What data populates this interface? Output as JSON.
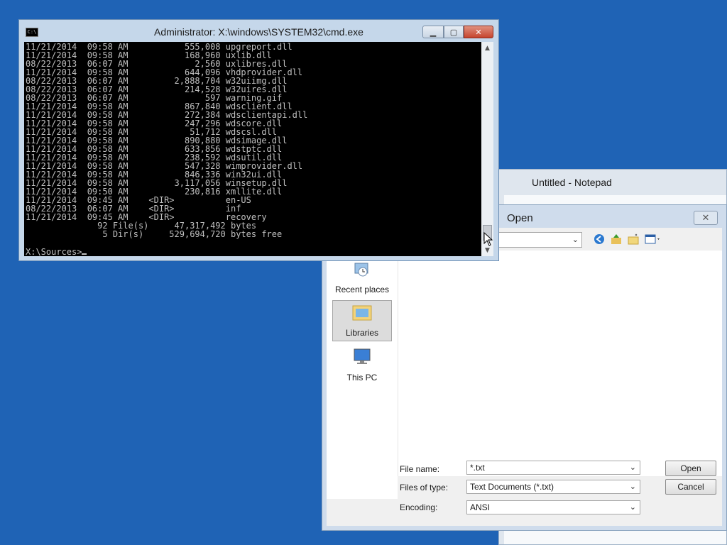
{
  "notepad": {
    "title": "Untitled - Notepad"
  },
  "open_dialog": {
    "title": "Open",
    "close_glyph": "✕",
    "nav": [
      {
        "label": "Recent places",
        "icon": "recent-places-icon",
        "selected": false
      },
      {
        "label": "Libraries",
        "icon": "libraries-icon",
        "selected": true
      },
      {
        "label": "This PC",
        "icon": "this-pc-icon",
        "selected": false
      }
    ],
    "file_name_label": "File name:",
    "file_name_value": "*.txt",
    "files_of_type_label": "Files of type:",
    "files_of_type_value": "Text Documents (*.txt)",
    "encoding_label": "Encoding:",
    "encoding_value": "ANSI",
    "open_button": "Open",
    "cancel_button": "Cancel"
  },
  "cmd": {
    "title": "Administrator: X:\\windows\\SYSTEM32\\cmd.exe",
    "icon_text": "C:\\",
    "lines": [
      "11/21/2014  09:58 AM           555,008 upgreport.dll",
      "11/21/2014  09:58 AM           168,960 uxlib.dll",
      "08/22/2013  06:07 AM             2,560 uxlibres.dll",
      "11/21/2014  09:58 AM           644,096 vhdprovider.dll",
      "08/22/2013  06:07 AM         2,888,704 w32uiimg.dll",
      "08/22/2013  06:07 AM           214,528 w32uires.dll",
      "08/22/2013  06:07 AM               597 warning.gif",
      "11/21/2014  09:58 AM           867,840 wdsclient.dll",
      "11/21/2014  09:58 AM           272,384 wdsclientapi.dll",
      "11/21/2014  09:58 AM           247,296 wdscore.dll",
      "11/21/2014  09:58 AM            51,712 wdscsl.dll",
      "11/21/2014  09:58 AM           890,880 wdsimage.dll",
      "11/21/2014  09:58 AM           633,856 wdstptc.dll",
      "11/21/2014  09:58 AM           238,592 wdsutil.dll",
      "11/21/2014  09:58 AM           547,328 wimprovider.dll",
      "11/21/2014  09:58 AM           846,336 win32ui.dll",
      "11/21/2014  09:58 AM         3,117,056 winsetup.dll",
      "11/21/2014  09:50 AM           230,816 xmllite.dll",
      "11/21/2014  09:45 AM    <DIR>          en-US",
      "08/22/2013  06:07 AM    <DIR>          inf",
      "11/21/2014  09:45 AM    <DIR>          recovery",
      "              92 File(s)     47,317,492 bytes",
      "               5 Dir(s)     529,694,720 bytes free",
      "",
      "X:\\Sources>"
    ]
  }
}
